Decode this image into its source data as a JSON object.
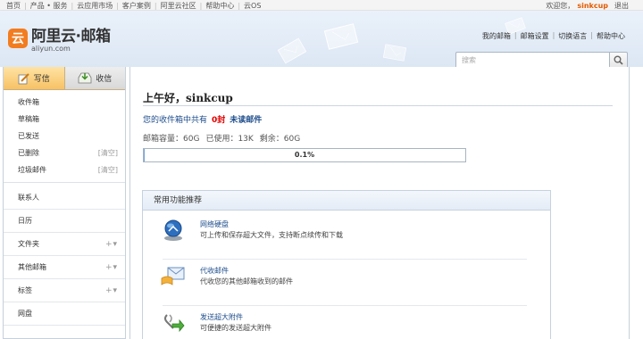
{
  "topbar": {
    "nav": [
      "首页",
      "产品 • 服务",
      "云应用市场",
      "客户案例",
      "阿里云社区",
      "帮助中心",
      "云OS"
    ],
    "welcome": "欢迎您，",
    "username": "sinkcup",
    "logout": "退出"
  },
  "header": {
    "logo_mark": "云",
    "logo_name": "阿里云·邮箱",
    "logo_domain": "aliyun.com",
    "links": [
      "我的邮箱",
      "邮箱设置",
      "切换语言",
      "帮助中心"
    ],
    "search_placeholder": "搜索"
  },
  "sidebar": {
    "compose": "写信",
    "receive": "收信",
    "folders": [
      {
        "label": "收件箱",
        "extra": ""
      },
      {
        "label": "草稿箱",
        "extra": ""
      },
      {
        "label": "已发送",
        "extra": ""
      },
      {
        "label": "已删除",
        "extra": "[清空]"
      },
      {
        "label": "垃圾邮件",
        "extra": "[清空]"
      }
    ],
    "groups": [
      {
        "label": "联系人",
        "ops": ""
      },
      {
        "label": "日历",
        "ops": ""
      },
      {
        "label": "文件夹",
        "ops": "+▾"
      },
      {
        "label": "其他邮箱",
        "ops": "+▾"
      },
      {
        "label": "标签",
        "ops": "+▾"
      },
      {
        "label": "网盘",
        "ops": ""
      }
    ]
  },
  "main": {
    "greeting": "上午好，sinkcup",
    "inbox_prefix": "您的收件箱中共有",
    "unread_count": "0封",
    "unread_label": "未读邮件",
    "capacity": "邮箱容量：60G",
    "used": "已使用：13K",
    "remaining": "剩余：60G",
    "usage_percent": 0.1,
    "usage_text": "0.1%",
    "features_title": "常用功能推荐",
    "features": [
      {
        "icon": "network-disk-icon",
        "title": "网络硬盘",
        "desc": "可上传和保存超大文件，支持断点续传和下载"
      },
      {
        "icon": "mail-collect-icon",
        "title": "代收邮件",
        "desc": "代收您的其他邮箱收到的邮件"
      },
      {
        "icon": "large-attachment-icon",
        "title": "发送超大附件",
        "desc": "可便捷的发送超大附件"
      }
    ]
  }
}
